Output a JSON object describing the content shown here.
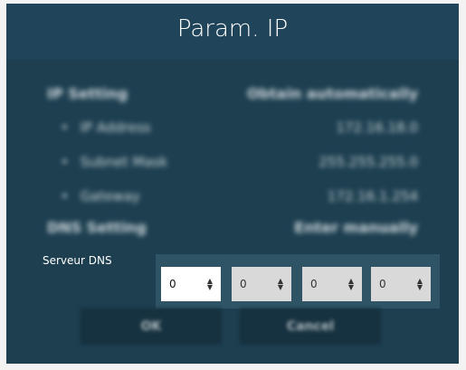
{
  "dialog": {
    "title": "Param. IP"
  },
  "settings": {
    "ip_setting": {
      "label": "IP Setting",
      "value": "Obtain automatically"
    },
    "ip_address": {
      "label": "IP Address",
      "value": "172.16.18.0"
    },
    "subnet_mask": {
      "label": "Subnet Mask",
      "value": "255.255.255.0"
    },
    "gateway": {
      "label": "Gateway",
      "value": "172.16.1.254"
    },
    "dns_setting": {
      "label": "DNS Setting",
      "value": "Enter manually"
    }
  },
  "dns": {
    "label": "Serveur DNS",
    "octets": [
      "0",
      "0",
      "0",
      "0"
    ]
  },
  "buttons": {
    "ok": "OK",
    "cancel": "Cancel"
  }
}
